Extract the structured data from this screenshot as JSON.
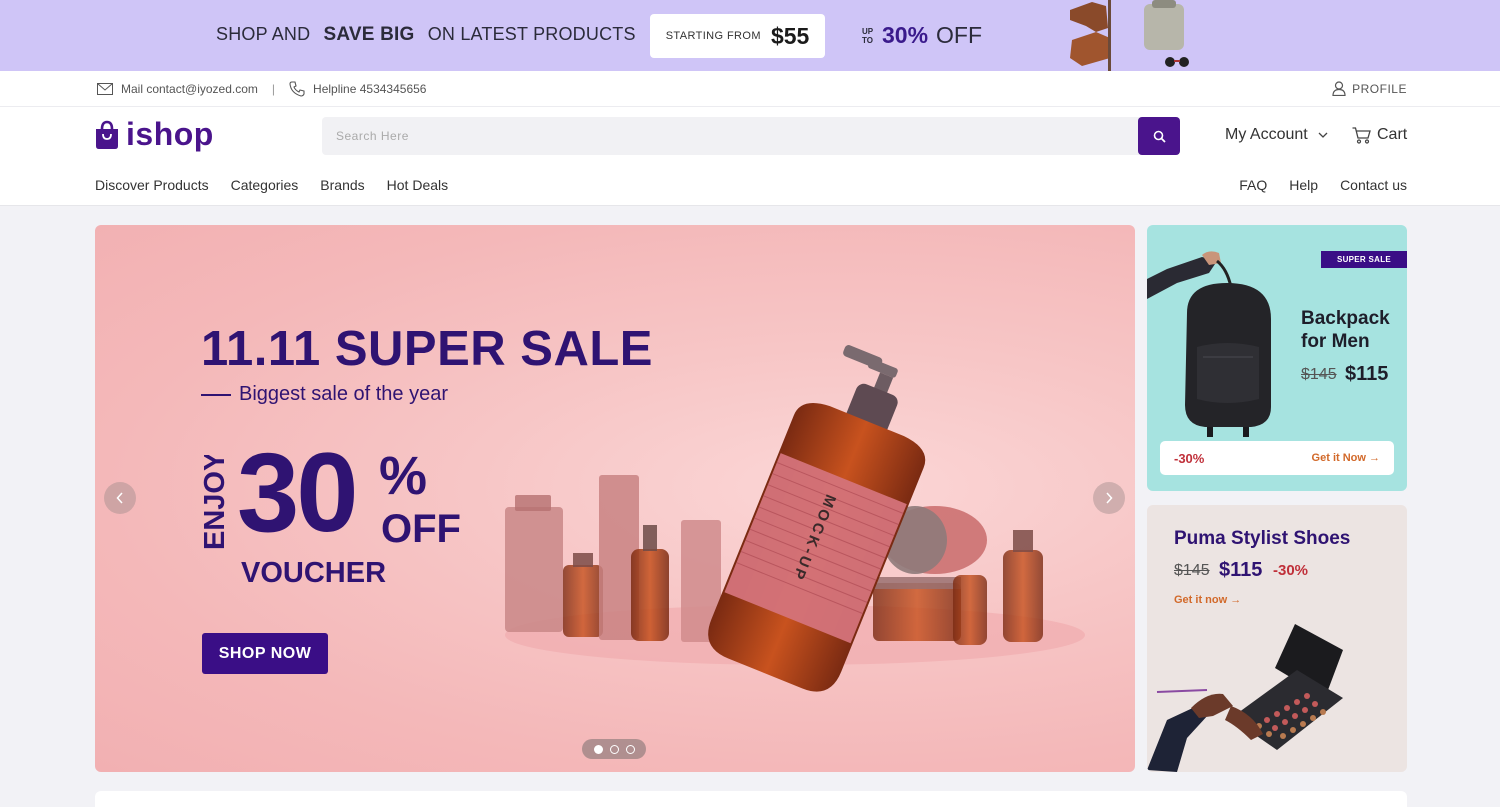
{
  "promo": {
    "text_before": "SHOP AND",
    "text_bold": "SAVE BIG",
    "text_after": "ON LATEST PRODUCTS",
    "starting_label": "STARTING FROM",
    "starting_price": "$55",
    "upto_line1": "UP",
    "upto_line2": "TO",
    "percent": "30%",
    "off": "OFF"
  },
  "infobar": {
    "mail": "Mail contact@iyozed.com",
    "separator": "|",
    "helpline": "Helpline 4534345656",
    "profile": "PROFILE"
  },
  "header": {
    "logo": "ishop",
    "search_placeholder": "Search Here",
    "my_account": "My Account",
    "cart": "Cart"
  },
  "nav": {
    "left": [
      "Discover Products",
      "Categories",
      "Brands",
      "Hot Deals"
    ],
    "right": [
      "FAQ",
      "Help",
      "Contact us"
    ]
  },
  "hero": {
    "title": "11.11 SUPER SALE",
    "subtitle": "Biggest sale of the year",
    "enjoy": "ENJOY",
    "big_number": "30",
    "percent": "%",
    "off": "OFF",
    "voucher": "VOUCHER",
    "button": "SHOP NOW",
    "bottle_label": "MOCK-UP",
    "slides": 3,
    "active_slide": 1
  },
  "card_backpack": {
    "badge": "SUPER SALE",
    "name_line1": "Backpack",
    "name_line2": "for Men",
    "old_price": "$145",
    "new_price": "$115",
    "discount": "-30%",
    "cta": "Get it Now →"
  },
  "card_shoes": {
    "name": "Puma Stylist Shoes",
    "old_price": "$145",
    "new_price": "$115",
    "discount": "-30%",
    "cta": "Get it now →"
  },
  "colors": {
    "brand": "#4a148c",
    "promo_bg": "#cfc5f7",
    "hero_bg": "#f4b8b9",
    "card1_bg": "#a6e3e0",
    "card2_bg": "#ece4e2",
    "discount": "#c0303a",
    "cta": "#d2692a"
  },
  "icons": [
    "mail-icon",
    "phone-icon",
    "user-icon",
    "shopping-bag-logo-icon",
    "search-icon",
    "chevron-down-icon",
    "cart-icon",
    "chevron-left-icon",
    "chevron-right-icon",
    "arrow-right-icon"
  ]
}
